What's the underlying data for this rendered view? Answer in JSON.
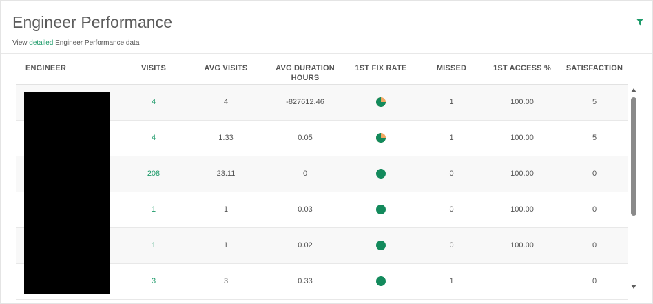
{
  "widget": {
    "title": "Engineer Performance",
    "subtitle_prefix": "View ",
    "subtitle_link": "detailed",
    "subtitle_suffix": " Engineer Performance data"
  },
  "colors": {
    "accent": "#1e9b6a",
    "pie_full": "#138a5c",
    "pie_partial": "#f0a862"
  },
  "table": {
    "headers": {
      "engineer": "ENGINEER",
      "visits": "VISITS",
      "avg_visits": "AVG VISITS",
      "avg_duration": "AVG DURATION HOURS",
      "fix_rate": "1ST FIX RATE",
      "missed": "MISSED",
      "access": "1ST ACCESS %",
      "satisfaction": "SATISFACTION"
    },
    "rows": [
      {
        "visits": "4",
        "avg_visits": "4",
        "avg_duration": "-827612.46",
        "fix_rate": 0.75,
        "missed": "1",
        "access": "100.00",
        "satisfaction": "5"
      },
      {
        "visits": "4",
        "avg_visits": "1.33",
        "avg_duration": "0.05",
        "fix_rate": 0.75,
        "missed": "1",
        "access": "100.00",
        "satisfaction": "5"
      },
      {
        "visits": "208",
        "avg_visits": "23.11",
        "avg_duration": "0",
        "fix_rate": 1.0,
        "missed": "0",
        "access": "100.00",
        "satisfaction": "0"
      },
      {
        "visits": "1",
        "avg_visits": "1",
        "avg_duration": "0.03",
        "fix_rate": 1.0,
        "missed": "0",
        "access": "100.00",
        "satisfaction": "0"
      },
      {
        "visits": "1",
        "avg_visits": "1",
        "avg_duration": "0.02",
        "fix_rate": 1.0,
        "missed": "0",
        "access": "100.00",
        "satisfaction": "0"
      },
      {
        "visits": "3",
        "avg_visits": "3",
        "avg_duration": "0.33",
        "fix_rate": 1.0,
        "missed": "1",
        "access": "",
        "satisfaction": "0"
      }
    ]
  },
  "icons": {
    "filter": "filter-icon",
    "scroll_up": "scroll-up-arrow-icon",
    "scroll_down": "scroll-down-arrow-icon"
  }
}
